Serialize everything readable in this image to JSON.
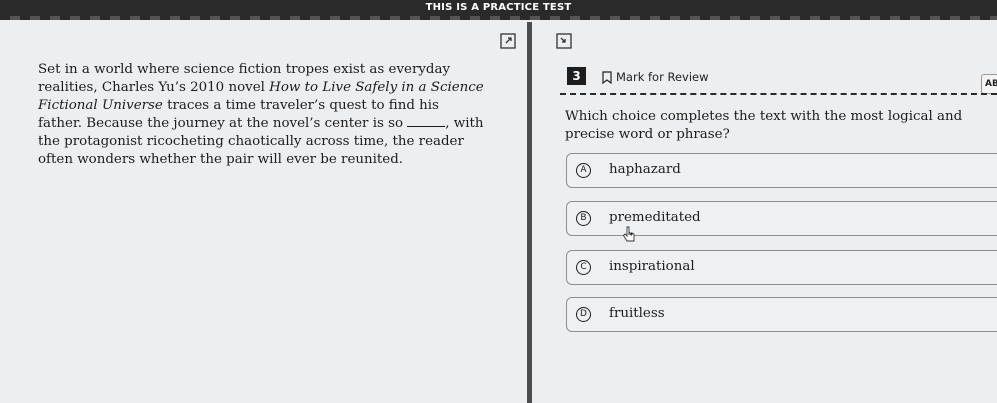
{
  "banner": {
    "title": "THIS IS A PRACTICE TEST"
  },
  "toolbar": {
    "expand_icon": "expand-icon",
    "collapse_icon": "collapse-icon"
  },
  "passage": {
    "line1": "Set in a world where science fiction tropes exist as everyday realities, Charles Yu’s 2010 novel ",
    "italic_title": "How to Live Safely in a Science Fictional Universe",
    "line2": " traces a time traveler’s quest to find his father. Because the journey at the novel’s center is so ",
    "line3": ", with the protagonist ricocheting chaotically across time, the reader often wonders whether the pair will ever be reunited."
  },
  "question": {
    "number": "3",
    "mark_label": "Mark for Review",
    "abc_label": "ABC",
    "prompt": "Which choice completes the text with the most logical and precise word or phrase?"
  },
  "choices": [
    {
      "letter": "A",
      "text": "haphazard"
    },
    {
      "letter": "B",
      "text": "premeditated"
    },
    {
      "letter": "C",
      "text": "inspirational"
    },
    {
      "letter": "D",
      "text": "fruitless"
    }
  ],
  "colors": {
    "banner": "#2a2a2a",
    "divider": "#4d4d4d",
    "background": "#eceef0"
  }
}
